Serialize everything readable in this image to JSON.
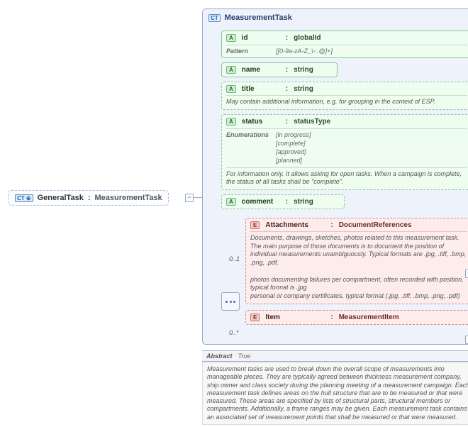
{
  "root": {
    "icon": "CT ⊕",
    "name": "GeneralTask",
    "type": "MeasurementTask"
  },
  "main": {
    "icon": "CT",
    "name": "MeasurementTask"
  },
  "attrs": {
    "id": {
      "name": "id",
      "type": "globalId",
      "pattern_label": "Pattern",
      "pattern": "[[0-9a-zA-Z_\\-:.@]+]"
    },
    "name": {
      "name": "name",
      "type": "string"
    },
    "title": {
      "name": "title",
      "type": "string",
      "desc": "May contain additional information, e.g. for grouping in the context of ESP."
    },
    "status": {
      "name": "status",
      "type": "statusType",
      "enum_label": "Enumerations",
      "enums": [
        "[in progress]",
        "[complete]",
        "[approved]",
        "[planned]"
      ],
      "desc": "For information only. It allows asking for open tasks. When a campaign is complete, the status of all tasks shall be \"complete\"."
    },
    "comment": {
      "name": "comment",
      "type": "string"
    }
  },
  "elems": {
    "attachments": {
      "name": "Attachments",
      "type": "DocumentReferences",
      "mult": "0..1",
      "desc": "Documents, drawings, sketches, photos related to this measurement task. The main purpose of those documents is to document the position of individual measurements unambiguously. Typical formats are .jpg, .tiff, .bmp, .png, .pdf.\n\n    photos documenting failures per compartment, often recorded with position, typical format is .jpg\n    personal or company certificates, typical format (.jpg, .tiff, .bmp, .png, .pdf)"
    },
    "item": {
      "name": "Item",
      "type": "MeasurementItem",
      "mult": "0..*"
    }
  },
  "abstract": {
    "label": "Abstract",
    "value": "True"
  },
  "description": "Measurement tasks are used to break down the overall scope of measurements into manageable pieces. They are typically agreed between thickness measurement company, ship owner and class society during the planning meeting of a measurement campaign. Each measurement task defines areas on the hull structure that are to be measured or that were measured. These areas are specified by lists of structural parts, structural members or compartments. Additionally, a frame ranges may be given. Each measurement task contains an associated set of measurement points that shall be measured or that were measured."
}
